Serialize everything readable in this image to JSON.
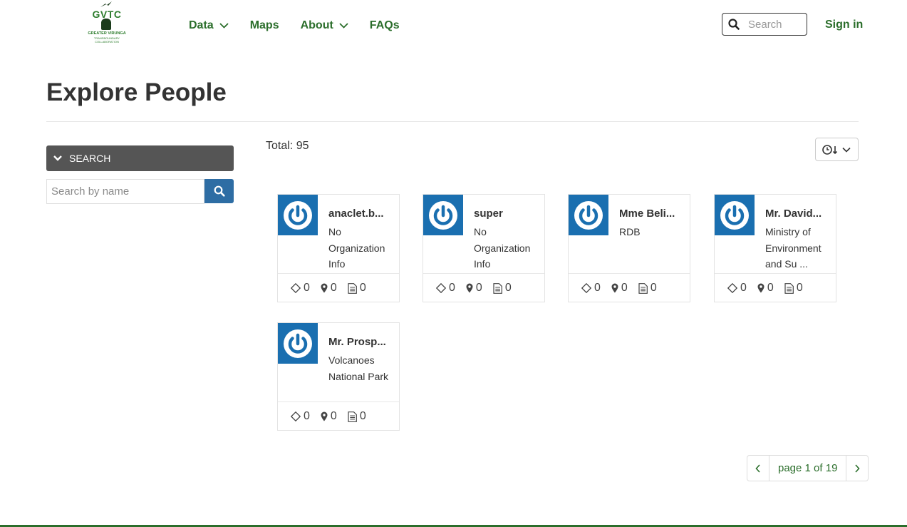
{
  "brand": {
    "logo_title": "GVTC",
    "logo_line1": "GREATER VIRUNGA",
    "logo_line2": "TRANSBOUNDARY COLLABORATION"
  },
  "nav": {
    "items": [
      {
        "label": "Data",
        "has_dropdown": true
      },
      {
        "label": "Maps",
        "has_dropdown": false
      },
      {
        "label": "About",
        "has_dropdown": true
      },
      {
        "label": "FAQs",
        "has_dropdown": false
      }
    ],
    "search_placeholder": "Search",
    "signin_label": "Sign in"
  },
  "page": {
    "title": "Explore People"
  },
  "sidebar": {
    "search_header": "SEARCH",
    "name_placeholder": "Search by name"
  },
  "results": {
    "total_label": "Total: 95",
    "people": [
      {
        "name": "anaclet.b...",
        "org": "No Organization Info",
        "resources": 0,
        "maps": 0,
        "documents": 0
      },
      {
        "name": "super",
        "org": "No Organization Info",
        "resources": 0,
        "maps": 0,
        "documents": 0
      },
      {
        "name": "Mme Beli...",
        "org": "RDB",
        "resources": 0,
        "maps": 0,
        "documents": 0
      },
      {
        "name": "Mr. David...",
        "org": "Ministry of Environment and Su ...",
        "resources": 0,
        "maps": 0,
        "documents": 0
      },
      {
        "name": "Mr. Prosp...",
        "org": "Volcanoes National Park",
        "resources": 0,
        "maps": 0,
        "documents": 0
      }
    ]
  },
  "pagination": {
    "label": "page 1 of 19"
  },
  "colors": {
    "brand_green": "#2b6e2b",
    "avatar_blue": "#1a6fb0",
    "search_button": "#2e6da4",
    "panel_gray": "#555555"
  },
  "icons": {
    "header_search": "search-icon",
    "nav_dropdown": "chevron-down-icon",
    "panel_toggle": "chevron-down-icon",
    "name_search": "search-icon",
    "sort": "clock-sort-icon",
    "avatar": "power-icon",
    "resources": "diamond-icon",
    "maps": "map-marker-icon",
    "documents": "document-icon",
    "prev": "chevron-left-icon",
    "next": "chevron-right-icon"
  }
}
